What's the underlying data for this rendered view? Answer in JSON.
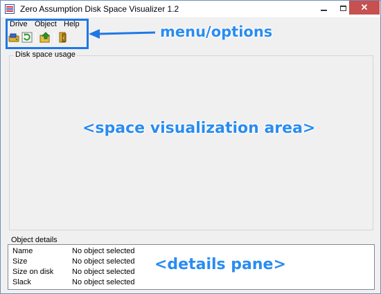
{
  "window": {
    "title": "Zero Assumption Disk Space Visualizer 1.2",
    "controls": {
      "minimize": "minimize",
      "maximize": "maximize",
      "close": "✕"
    }
  },
  "menu": {
    "items": [
      {
        "label": "Drive"
      },
      {
        "label": "Object"
      },
      {
        "label": "Help"
      }
    ]
  },
  "toolbar": {
    "buttons": [
      {
        "icon": "open-drive-icon"
      },
      {
        "icon": "refresh-icon"
      },
      {
        "icon": "up-folder-icon"
      },
      {
        "icon": "exit-icon"
      }
    ]
  },
  "visualization": {
    "group_label": "Disk space usage"
  },
  "details": {
    "group_label": "Object details",
    "rows": [
      {
        "key": "Name",
        "value": "No object selected"
      },
      {
        "key": "Size",
        "value": "No object selected"
      },
      {
        "key": "Size on disk",
        "value": "No object selected"
      },
      {
        "key": "Slack",
        "value": "No object selected"
      }
    ]
  },
  "annotations": {
    "menu_options": "menu/options",
    "space_area": "<space visualization area>",
    "details_pane": "<details pane>",
    "accent_color": "#1e78e6"
  }
}
